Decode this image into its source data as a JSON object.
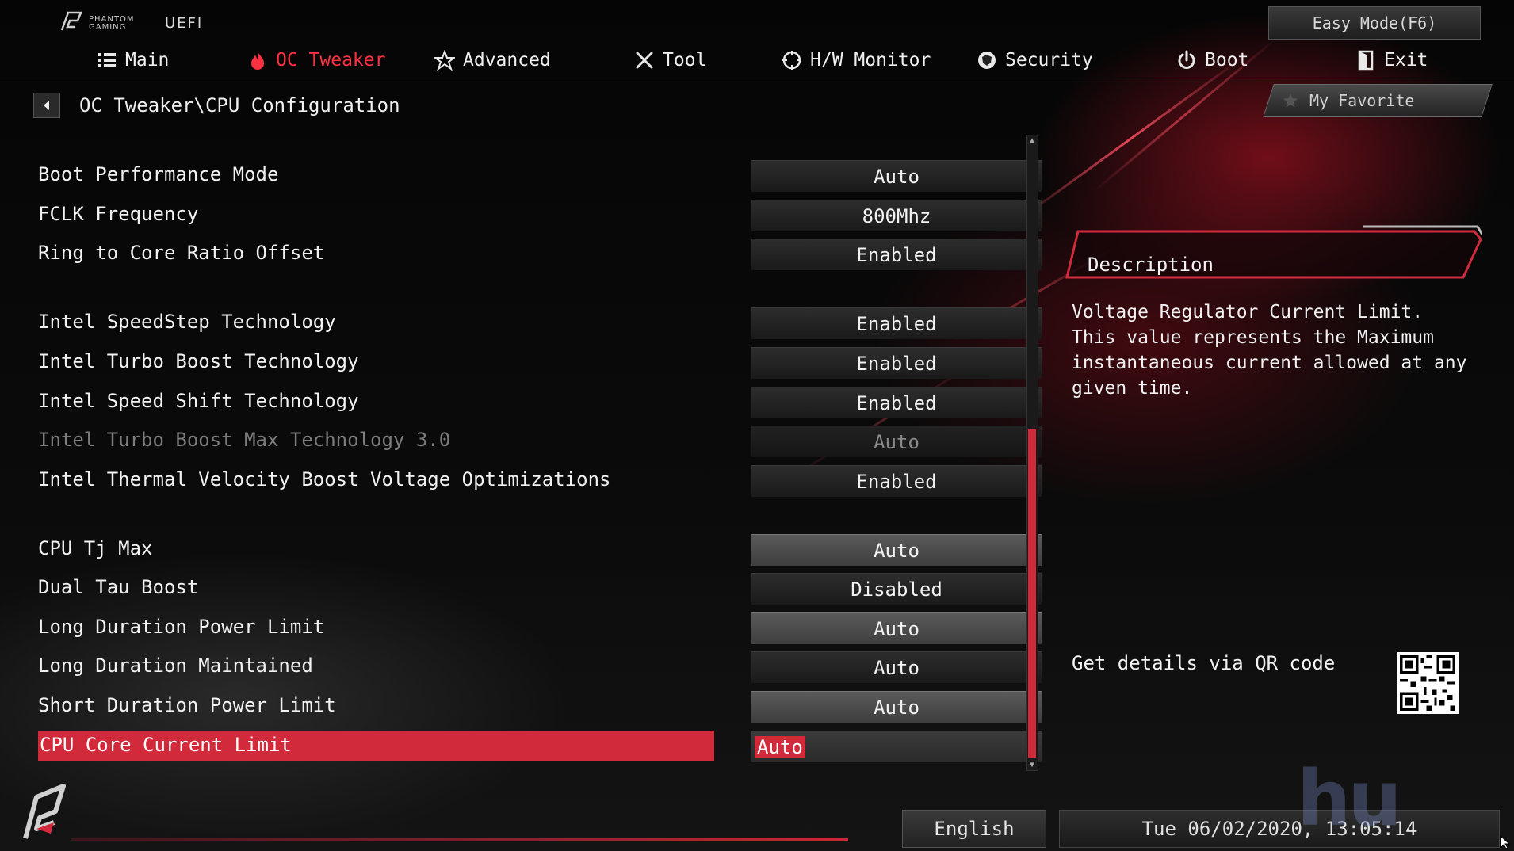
{
  "header": {
    "logo_brand": "PHANTOM GAMING",
    "logo_uefi": "UEFI",
    "easy_mode_label": "Easy Mode(F6)"
  },
  "tabs": [
    {
      "label": "Main",
      "icon": "list-icon",
      "active": false
    },
    {
      "label": "OC Tweaker",
      "icon": "flame-icon",
      "active": true
    },
    {
      "label": "Advanced",
      "icon": "star-icon",
      "active": false
    },
    {
      "label": "Tool",
      "icon": "tools-icon",
      "active": false
    },
    {
      "label": "H/W Monitor",
      "icon": "monitor-icon",
      "active": false
    },
    {
      "label": "Security",
      "icon": "shield-icon",
      "active": false
    },
    {
      "label": "Boot",
      "icon": "power-icon",
      "active": false
    },
    {
      "label": "Exit",
      "icon": "exit-door-icon",
      "active": false
    }
  ],
  "breadcrumb": "OC Tweaker\\CPU Configuration",
  "favorite_label": "My Favorite",
  "settings": [
    {
      "label": "Boot Performance Mode",
      "value": "Auto",
      "state": "normal"
    },
    {
      "label": "FCLK Frequency",
      "value": "800Mhz",
      "state": "normal"
    },
    {
      "label": "Ring to Core Ratio Offset",
      "value": "Enabled",
      "state": "normal"
    },
    {
      "label": "Intel SpeedStep Technology",
      "value": "Enabled",
      "state": "normal"
    },
    {
      "label": "Intel Turbo Boost Technology",
      "value": "Enabled",
      "state": "normal"
    },
    {
      "label": "Intel Speed Shift Technology",
      "value": "Enabled",
      "state": "normal"
    },
    {
      "label": "Intel Turbo Boost Max Technology 3.0",
      "value": "Auto",
      "state": "disabled"
    },
    {
      "label": "Intel Thermal Velocity Boost Voltage Optimizations",
      "value": "Enabled",
      "state": "normal"
    },
    {
      "label": "CPU Tj Max",
      "value": "Auto",
      "state": "input"
    },
    {
      "label": "Dual Tau Boost",
      "value": "Disabled",
      "state": "normal"
    },
    {
      "label": "Long Duration Power Limit",
      "value": "Auto",
      "state": "input"
    },
    {
      "label": "Long Duration Maintained",
      "value": "Auto",
      "state": "normal"
    },
    {
      "label": "Short Duration Power Limit",
      "value": "Auto",
      "state": "input"
    },
    {
      "label": "CPU Core Current Limit",
      "value": "Auto",
      "state": "selected"
    }
  ],
  "scrollbar": {
    "thumb_start_fraction": 0.46,
    "thumb_length_fraction": 0.52
  },
  "description": {
    "title": "Description",
    "text": "Voltage Regulator Current Limit. This value represents the Maximum instantaneous current allowed at any given time.",
    "qr_label": "Get details via QR code"
  },
  "footer": {
    "language": "English",
    "datetime": "Tue 06/02/2020, 13:05:14",
    "watermark": "hu"
  },
  "colors": {
    "accent": "#d12a3a",
    "active_tab": "#ff3040",
    "text": "#f2f2f2",
    "disabled_text": "#7c7c7c"
  }
}
